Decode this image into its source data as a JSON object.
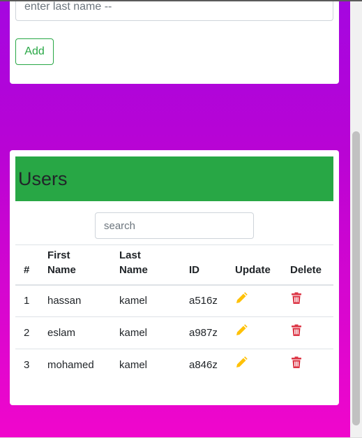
{
  "form": {
    "last_name_placeholder": "enter last name --",
    "add_label": "Add"
  },
  "users": {
    "title": "Users",
    "search_placeholder": "search",
    "columns": {
      "num": "#",
      "first_name": "First Name",
      "last_name": "Last Name",
      "id": "ID",
      "update": "Update",
      "delete": "Delete"
    },
    "rows": [
      {
        "num": "1",
        "first_name": "hassan",
        "last_name": "kamel",
        "id": "a516z"
      },
      {
        "num": "2",
        "first_name": "eslam",
        "last_name": "kamel",
        "id": "a987z"
      },
      {
        "num": "3",
        "first_name": "mohamed",
        "last_name": "kamel",
        "id": "a846z"
      }
    ]
  },
  "icons": {
    "update": "pencil-icon",
    "delete": "trash-icon"
  },
  "colors": {
    "success": "#28a745",
    "edit_icon": "#ffc107",
    "delete_icon": "#dc3545",
    "background_top": "#a506e0",
    "background_bottom": "#f006cc"
  }
}
